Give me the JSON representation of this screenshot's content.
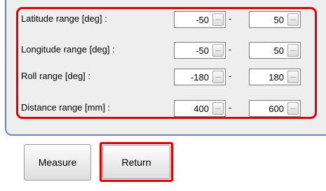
{
  "ranges": [
    {
      "label": "Latitude range [deg] :",
      "min": "-50",
      "max": "50"
    },
    {
      "label": "Longitude range [deg] :",
      "min": "-50",
      "max": "50"
    },
    {
      "label": "Roll range [deg] :",
      "min": "-180",
      "max": "180"
    },
    {
      "label": "Distance range [mm] :",
      "min": "400",
      "max": "600"
    }
  ],
  "separator": "-",
  "ellipsis": "...",
  "buttons": {
    "measure": "Measure",
    "return": "Return"
  },
  "colors": {
    "highlight": "#e00000",
    "panel_border": "#6b86b5",
    "panel_bg": "#eeeeee"
  }
}
